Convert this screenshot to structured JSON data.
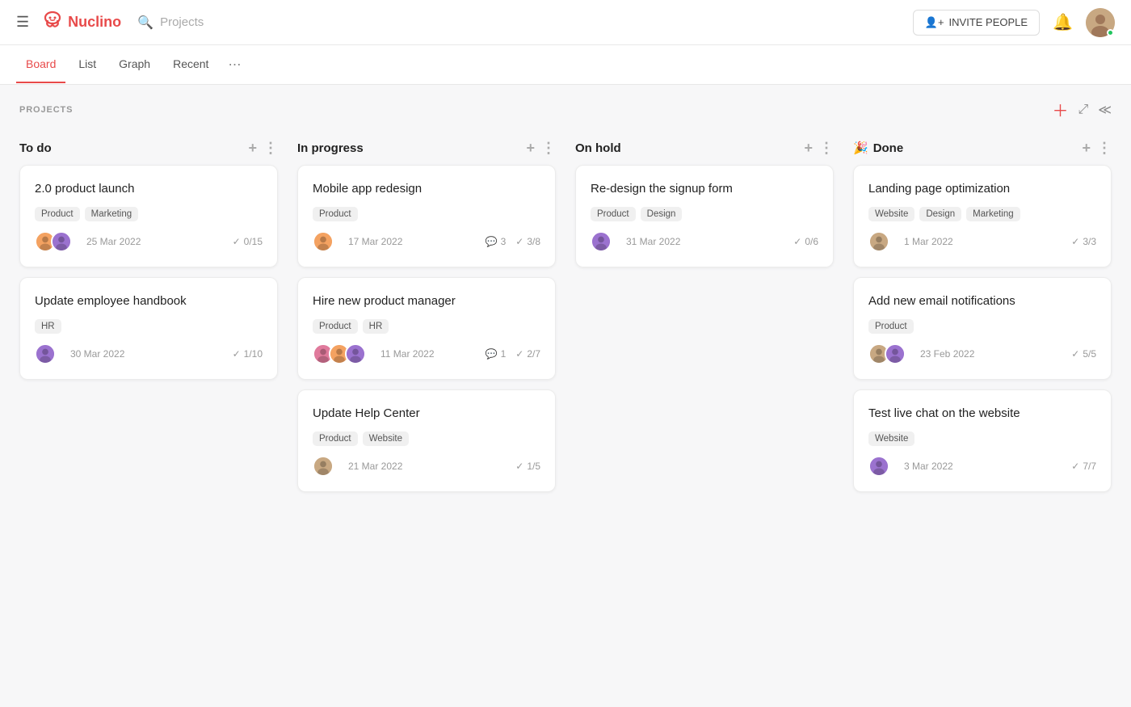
{
  "header": {
    "logo_text": "Nuclino",
    "search_placeholder": "Projects",
    "invite_label": "INVITE PEOPLE"
  },
  "tabs": {
    "items": [
      {
        "id": "board",
        "label": "Board",
        "active": true
      },
      {
        "id": "list",
        "label": "List",
        "active": false
      },
      {
        "id": "graph",
        "label": "Graph",
        "active": false
      },
      {
        "id": "recent",
        "label": "Recent",
        "active": false
      }
    ],
    "more_label": "⋯"
  },
  "board": {
    "section_label": "PROJECTS",
    "columns": [
      {
        "id": "todo",
        "title": "To do",
        "emoji": "",
        "cards": [
          {
            "id": "card-1",
            "title": "2.0 product launch",
            "tags": [
              "Product",
              "Marketing"
            ],
            "date": "25 Mar 2022",
            "avatars": [
              "orange",
              "purple"
            ],
            "checklist": "0/15",
            "comments": null
          },
          {
            "id": "card-2",
            "title": "Update employee handbook",
            "tags": [
              "HR"
            ],
            "date": "30 Mar 2022",
            "avatars": [
              "purple"
            ],
            "checklist": "1/10",
            "comments": null
          }
        ]
      },
      {
        "id": "inprogress",
        "title": "In progress",
        "emoji": "",
        "cards": [
          {
            "id": "card-3",
            "title": "Mobile app redesign",
            "tags": [
              "Product"
            ],
            "date": "17 Mar 2022",
            "avatars": [
              "orange"
            ],
            "checklist": "3/8",
            "comments": "3"
          },
          {
            "id": "card-4",
            "title": "Hire new product manager",
            "tags": [
              "Product",
              "HR"
            ],
            "date": "11 Mar 2022",
            "avatars": [
              "pink",
              "orange",
              "purple"
            ],
            "checklist": "2/7",
            "comments": "1"
          },
          {
            "id": "card-5",
            "title": "Update Help Center",
            "tags": [
              "Product",
              "Website"
            ],
            "date": "21 Mar 2022",
            "avatars": [
              "brown"
            ],
            "checklist": "1/5",
            "comments": null
          }
        ]
      },
      {
        "id": "onhold",
        "title": "On hold",
        "emoji": "",
        "cards": [
          {
            "id": "card-6",
            "title": "Re-design the signup form",
            "tags": [
              "Product",
              "Design"
            ],
            "date": "31 Mar 2022",
            "avatars": [
              "purple"
            ],
            "checklist": "0/6",
            "comments": null
          }
        ]
      },
      {
        "id": "done",
        "title": "Done",
        "emoji": "🎉",
        "cards": [
          {
            "id": "card-7",
            "title": "Landing page optimization",
            "tags": [
              "Website",
              "Design",
              "Marketing"
            ],
            "date": "1 Mar 2022",
            "avatars": [
              "brown"
            ],
            "checklist": "3/3",
            "comments": null
          },
          {
            "id": "card-8",
            "title": "Add new email notifications",
            "tags": [
              "Product"
            ],
            "date": "23 Feb 2022",
            "avatars": [
              "brown",
              "purple"
            ],
            "checklist": "5/5",
            "comments": null
          },
          {
            "id": "card-9",
            "title": "Test live chat on the website",
            "tags": [
              "Website"
            ],
            "date": "3 Mar 2022",
            "avatars": [
              "purple"
            ],
            "checklist": "7/7",
            "comments": null
          }
        ]
      }
    ]
  },
  "avatarColors": {
    "orange": "#f4a261",
    "purple": "#9b72cf",
    "teal": "#4a9d8e",
    "pink": "#e07a9c",
    "brown": "#c8a882",
    "blue": "#6b9fd4"
  }
}
